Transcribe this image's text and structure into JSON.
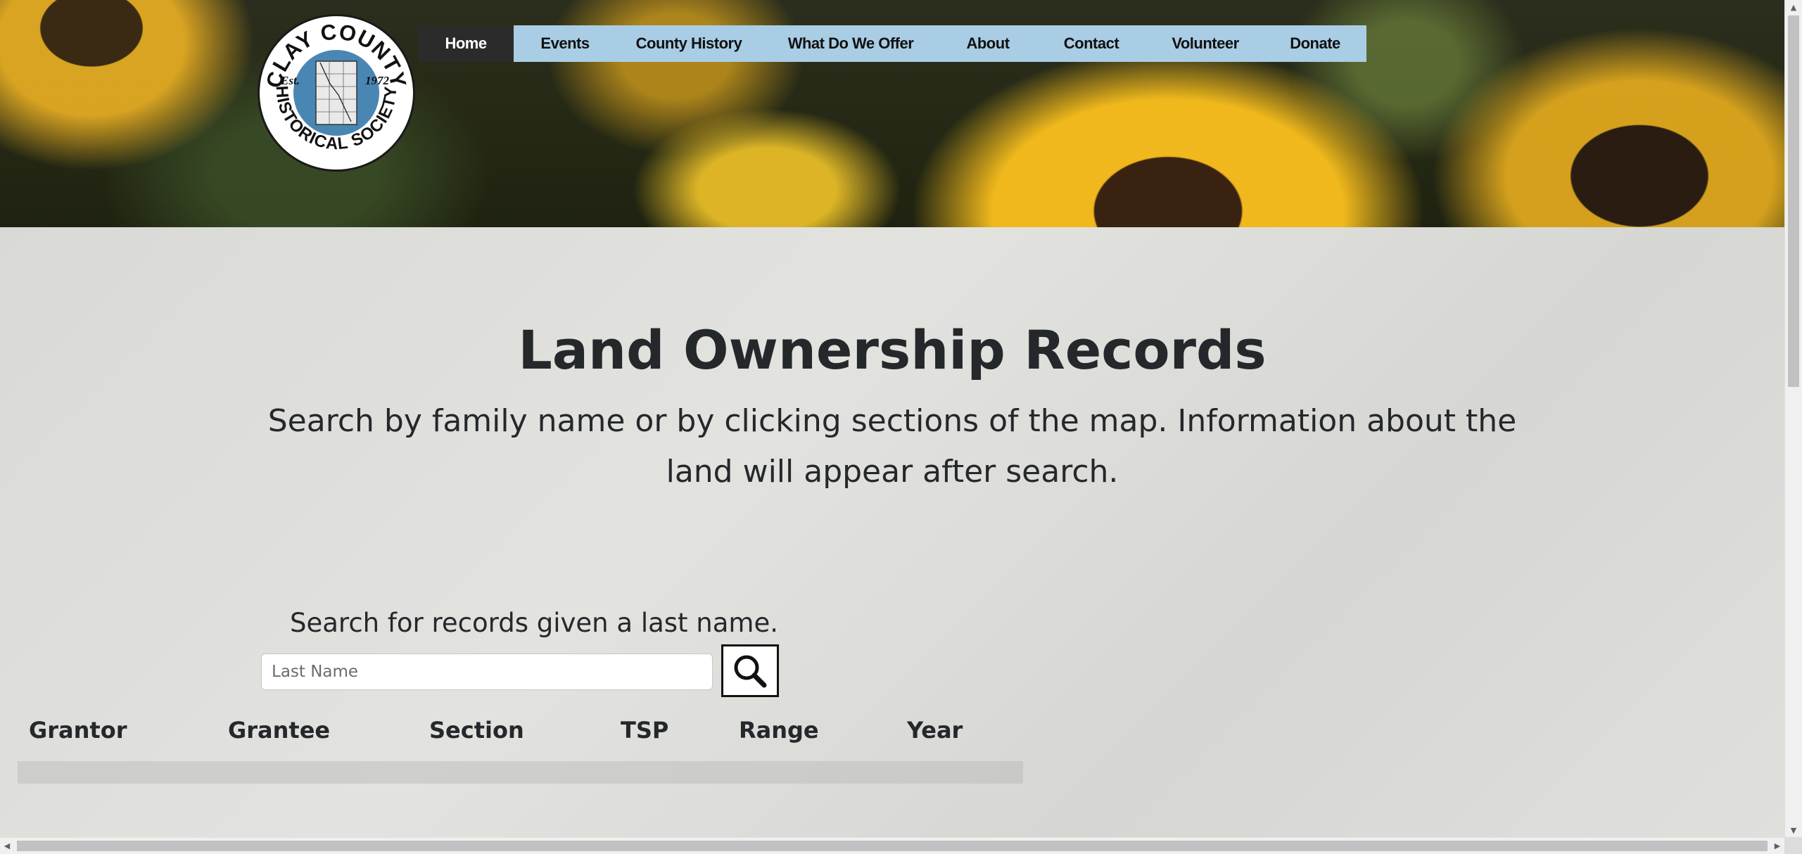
{
  "logo": {
    "top_text": "CLAY COUNTY",
    "bottom_text": "HISTORICAL SOCIETY",
    "left_text": "Est.",
    "right_text": "1972"
  },
  "nav": {
    "items": [
      {
        "label": "Home",
        "active": true
      },
      {
        "label": "Events"
      },
      {
        "label": "County History"
      },
      {
        "label": "What Do We Offer"
      },
      {
        "label": "About"
      },
      {
        "label": "Contact"
      },
      {
        "label": "Volunteer"
      },
      {
        "label": "Donate"
      }
    ]
  },
  "page": {
    "title": "Land Ownership Records",
    "subtitle": "Search by family name or by clicking sections of the map. Information about the land will appear after search."
  },
  "search": {
    "label": "Search for records given a last name.",
    "placeholder": "Last Name",
    "value": ""
  },
  "table": {
    "headers": [
      "Grantor",
      "Grantee",
      "Section",
      "TSP",
      "Range",
      "Year"
    ]
  },
  "colors": {
    "nav_bg": "#a9cde4",
    "nav_active": "#2b2b2b",
    "text": "#25282b",
    "logo_blue": "#4a86b4"
  }
}
